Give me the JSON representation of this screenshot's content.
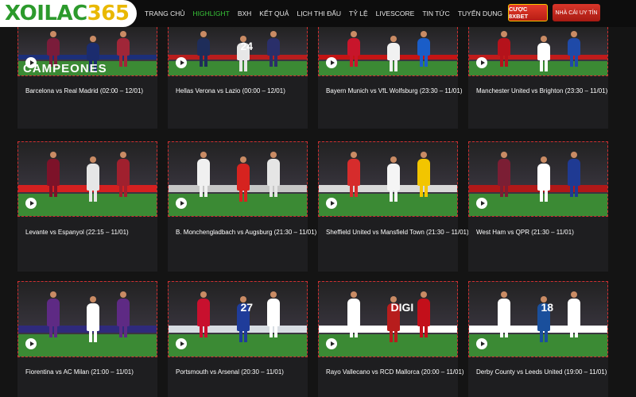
{
  "logo": {
    "part1": "XOILAC",
    "part2": "365"
  },
  "nav": [
    "TRANG CHỦ",
    "HIGHLIGHT",
    "BXH",
    "KẾT QUẢ",
    "LỊCH THI ĐẤU",
    "TỶ LỆ",
    "LIVESCORE",
    "TIN TỨC",
    "TUYỂN DỤNG"
  ],
  "nav_active": "HIGHLIGHT",
  "buttons": {
    "bet": "CƯỢC 8XBET",
    "nha_cai": "NHÀ CÁI UY TÍN"
  },
  "colors": {
    "accent_green": "#38c438",
    "card_border": "#d12f2f",
    "button_red": "#d9362a",
    "button_border": "#f4c400"
  },
  "matches": [
    {
      "title": "Barcelona vs Real Madrid (02:00 – 12/01)",
      "overlay": "CAMPEONES"
    },
    {
      "title": "Hellas Verona vs Lazio (00:00 – 12/01)",
      "overlay": "24"
    },
    {
      "title": "Bayern Munich vs VfL Wolfsburg (23:30 – 11/01)",
      "overlay": ""
    },
    {
      "title": "Manchester United vs Brighton (23:30 – 11/01)",
      "overlay": ""
    },
    {
      "title": "Levante vs Espanyol (22:15 – 11/01)",
      "overlay": ""
    },
    {
      "title": "B. Monchengladbach vs Augsburg (21:30 – 11/01)",
      "overlay": ""
    },
    {
      "title": "Sheffield United vs Mansfield Town (21:30 – 11/01)",
      "overlay": ""
    },
    {
      "title": "West Ham vs QPR (21:30 – 11/01)",
      "overlay": ""
    },
    {
      "title": "Fiorentina vs AC Milan (21:00 – 11/01)",
      "overlay": ""
    },
    {
      "title": "Portsmouth vs Arsenal (20:30 – 11/01)",
      "overlay": "27"
    },
    {
      "title": "Rayo Vallecano vs RCD Mallorca (20:00 – 11/01)",
      "overlay": "DIGI"
    },
    {
      "title": "Derby County vs Leeds United (19:00 – 11/01)",
      "overlay": "18"
    }
  ]
}
